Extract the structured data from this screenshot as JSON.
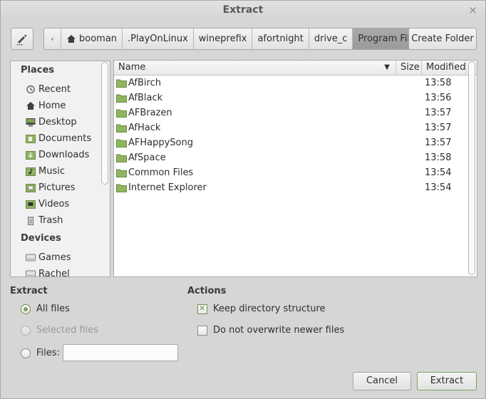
{
  "window": {
    "title": "Extract",
    "close_glyph": "×"
  },
  "toolbar": {
    "edit_icon": "pencil-icon",
    "back_glyph": "‹",
    "breadcrumbs": [
      "booman",
      ".PlayOnLinux",
      "wineprefix",
      "afortnight",
      "drive_c",
      "Program Files"
    ],
    "create_folder_label": "Create Folder"
  },
  "sidebar": {
    "places_title": "Places",
    "places": [
      {
        "label": "Recent",
        "icon": "recent-icon"
      },
      {
        "label": "Home",
        "icon": "home-icon"
      },
      {
        "label": "Desktop",
        "icon": "desktop-icon"
      },
      {
        "label": "Documents",
        "icon": "documents-icon"
      },
      {
        "label": "Downloads",
        "icon": "downloads-icon"
      },
      {
        "label": "Music",
        "icon": "music-icon"
      },
      {
        "label": "Pictures",
        "icon": "pictures-icon"
      },
      {
        "label": "Videos",
        "icon": "videos-icon"
      },
      {
        "label": "Trash",
        "icon": "trash-icon"
      }
    ],
    "devices_title": "Devices",
    "devices": [
      {
        "label": "Games",
        "icon": "drive-icon"
      },
      {
        "label": "Rachel",
        "icon": "drive-icon"
      }
    ]
  },
  "file_list": {
    "columns": {
      "name": "Name",
      "size": "Size",
      "modified": "Modified"
    },
    "rows": [
      {
        "name": "AfBirch",
        "size": "",
        "modified": "13:58"
      },
      {
        "name": "AfBlack",
        "size": "",
        "modified": "13:56"
      },
      {
        "name": "AFBrazen",
        "size": "",
        "modified": "13:57"
      },
      {
        "name": "AfHack",
        "size": "",
        "modified": "13:57"
      },
      {
        "name": "AFHappySong",
        "size": "",
        "modified": "13:57"
      },
      {
        "name": "AfSpace",
        "size": "",
        "modified": "13:58"
      },
      {
        "name": "Common Files",
        "size": "",
        "modified": "13:54"
      },
      {
        "name": "Internet Explorer",
        "size": "",
        "modified": "13:54"
      }
    ]
  },
  "extract_options": {
    "title": "Extract",
    "all_files": "All files",
    "selected_files": "Selected files",
    "files": "Files:",
    "files_value": ""
  },
  "actions": {
    "title": "Actions",
    "keep_structure": "Keep directory structure",
    "keep_structure_checked": true,
    "no_overwrite": "Do not overwrite newer files",
    "no_overwrite_checked": false
  },
  "buttons": {
    "cancel": "Cancel",
    "extract": "Extract"
  },
  "colors": {
    "accent": "#7ea35a",
    "folder": "#8fb560",
    "active_crumb": "#a3a3a3"
  }
}
